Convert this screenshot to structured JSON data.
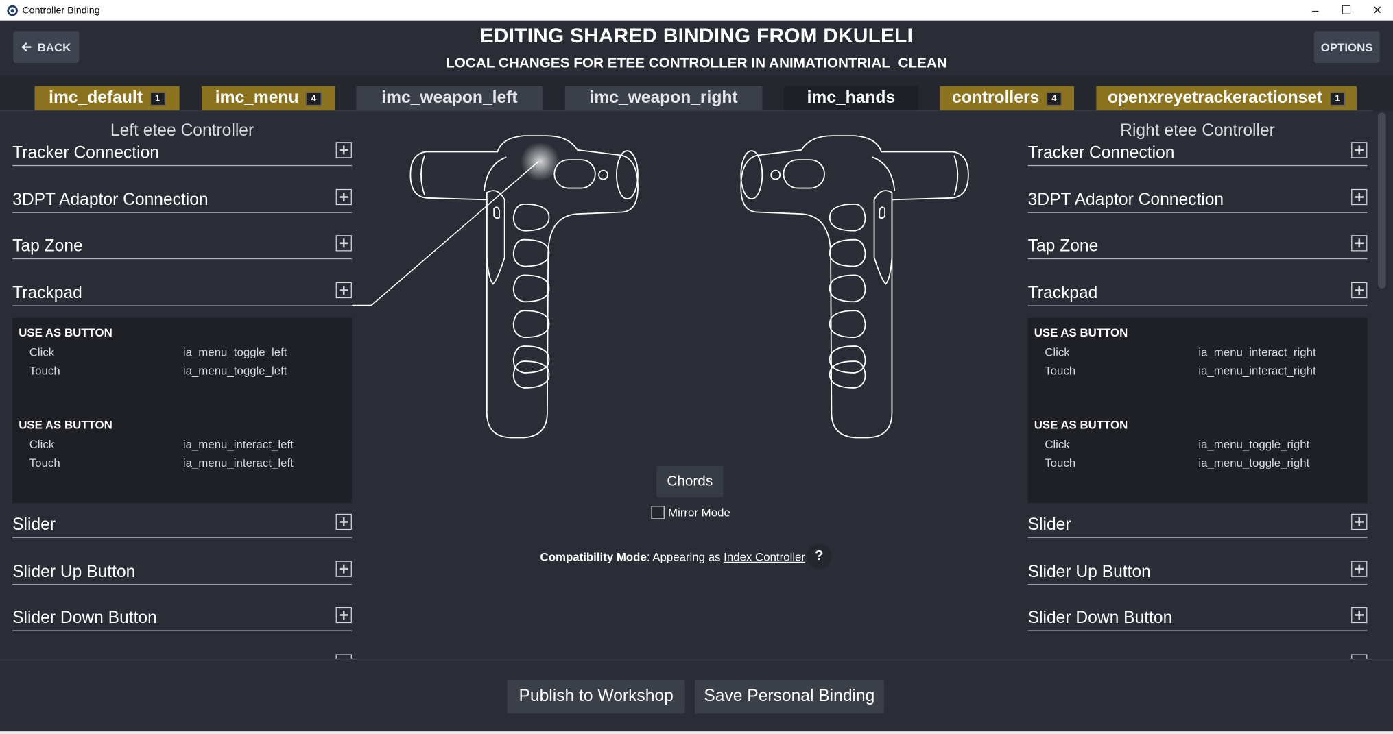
{
  "window": {
    "title": "Controller Binding",
    "minimize": "–",
    "maximize": "☐",
    "close": "✕"
  },
  "header": {
    "back_label": "BACK",
    "title": "EDITING SHARED BINDING FROM DKULELI",
    "subtitle": "LOCAL CHANGES FOR ETEE CONTROLLER IN ANIMATIONTRIAL_CLEAN",
    "options_label": "OPTIONS"
  },
  "tabs": [
    {
      "label": "imc_default",
      "count": "1",
      "state": "modified"
    },
    {
      "label": "imc_menu",
      "count": "4",
      "state": "modified"
    },
    {
      "label": "imc_weapon_left",
      "count": "",
      "state": "normal"
    },
    {
      "label": "imc_weapon_right",
      "count": "",
      "state": "normal"
    },
    {
      "label": "imc_hands",
      "count": "",
      "state": "active"
    },
    {
      "label": "controllers",
      "count": "4",
      "state": "modified"
    },
    {
      "label": "openxreyetrackeractionset",
      "count": "1",
      "state": "modified"
    }
  ],
  "left": {
    "title": "Left etee Controller",
    "sections": {
      "tracker": "Tracker Connection",
      "adaptor": "3DPT Adaptor Connection",
      "tap": "Tap Zone",
      "trackpad": "Trackpad",
      "slider": "Slider",
      "slider_up": "Slider Up Button",
      "slider_down": "Slider Down Button"
    },
    "bindings": [
      {
        "mode": "USE AS BUTTON",
        "click": "Click",
        "click_value": "ia_menu_toggle_left",
        "touch": "Touch",
        "touch_value": "ia_menu_toggle_left"
      },
      {
        "mode": "USE AS BUTTON",
        "click": "Click",
        "click_value": "ia_menu_interact_left",
        "touch": "Touch",
        "touch_value": "ia_menu_interact_left"
      }
    ]
  },
  "right": {
    "title": "Right etee Controller",
    "sections": {
      "tracker": "Tracker Connection",
      "adaptor": "3DPT Adaptor Connection",
      "tap": "Tap Zone",
      "trackpad": "Trackpad",
      "slider": "Slider",
      "slider_up": "Slider Up Button",
      "slider_down": "Slider Down Button"
    },
    "bindings": [
      {
        "mode": "USE AS BUTTON",
        "click": "Click",
        "click_value": "ia_menu_interact_right",
        "touch": "Touch",
        "touch_value": "ia_menu_interact_right"
      },
      {
        "mode": "USE AS BUTTON",
        "click": "Click",
        "click_value": "ia_menu_toggle_right",
        "touch": "Touch",
        "touch_value": "ia_menu_toggle_right"
      }
    ]
  },
  "center": {
    "chords_label": "Chords",
    "mirror_label": "Mirror Mode",
    "compat_label": "Compatibility Mode",
    "compat_text": ": Appearing as ",
    "compat_link": "Index Controller",
    "help_label": "?"
  },
  "footer": {
    "publish_label": "Publish to Workshop",
    "save_label": "Save Personal Binding"
  },
  "colors": {
    "modified_tab": "#8c7320",
    "background": "#2a2d35",
    "binding_panel": "#1e2026"
  }
}
